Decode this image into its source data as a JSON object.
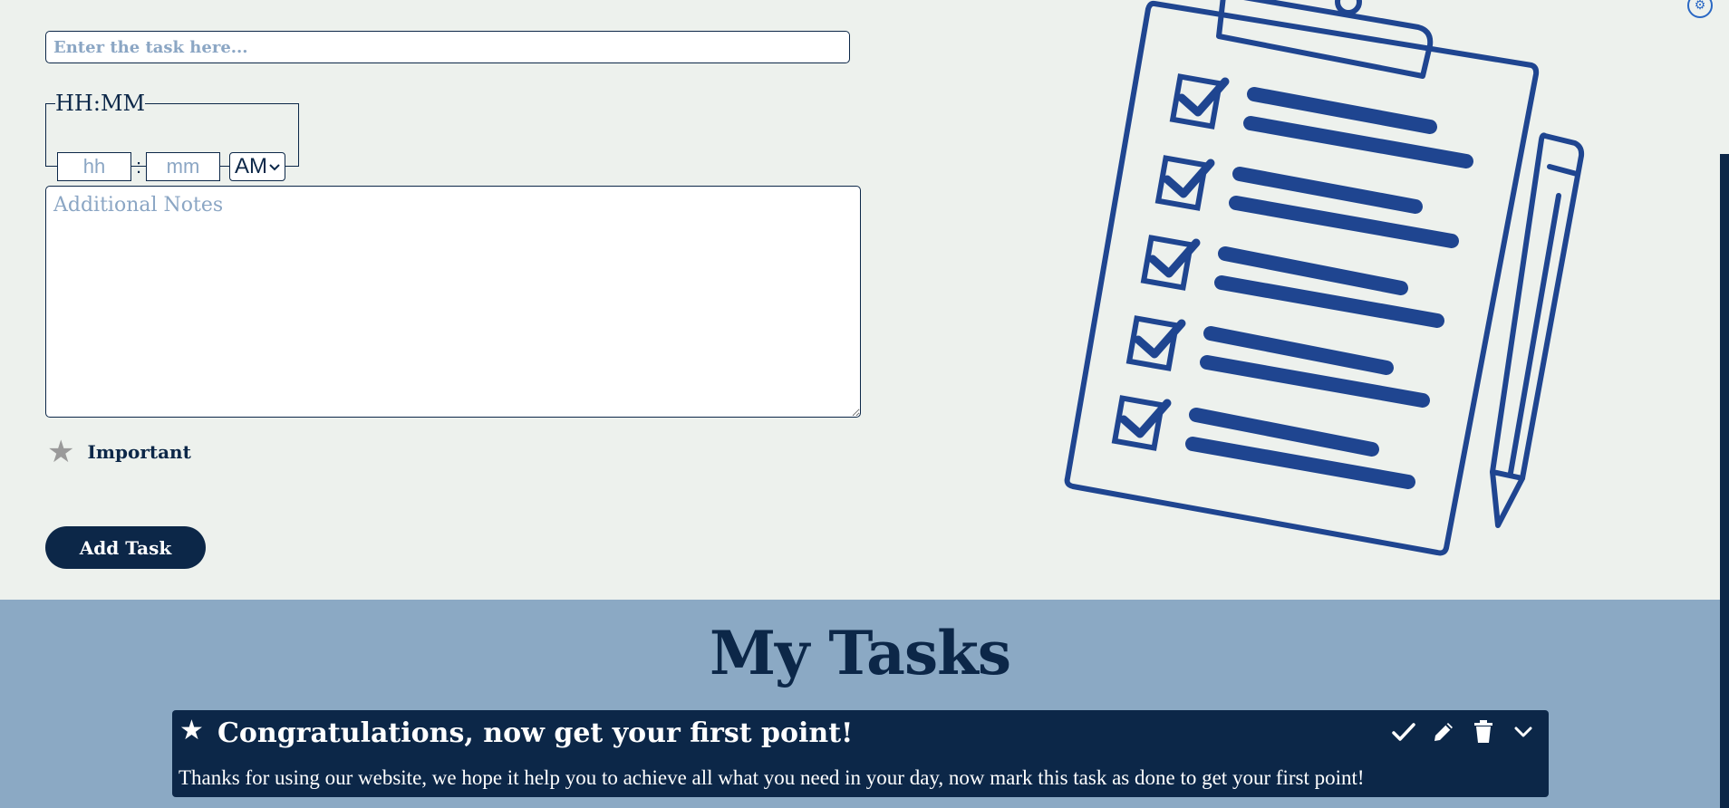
{
  "form": {
    "task_placeholder": "Enter the task here...",
    "time_legend": "HH:MM",
    "hour_placeholder": "hh",
    "minute_placeholder": "mm",
    "colon": ":",
    "ampm_selected": "AM",
    "notes_placeholder": "Additional Notes",
    "important_label": "Important",
    "add_button_label": "Add Task"
  },
  "illustration": {
    "icon": "clipboard-checklist-pencil",
    "color": "#1f4590"
  },
  "tasks": {
    "heading": "My Tasks",
    "items": [
      {
        "title": "Congratulations, now get your first point!",
        "notes": "Thanks for using our website, we hope it help you to achieve all what you need in your day, now mark this task as done to get your first point!",
        "important": true
      }
    ]
  },
  "colors": {
    "background": "#edf1ed",
    "primary": "#0c2748",
    "section_bg": "#8ba9c4",
    "placeholder": "#8ba6c4",
    "illustration": "#1f4590"
  }
}
